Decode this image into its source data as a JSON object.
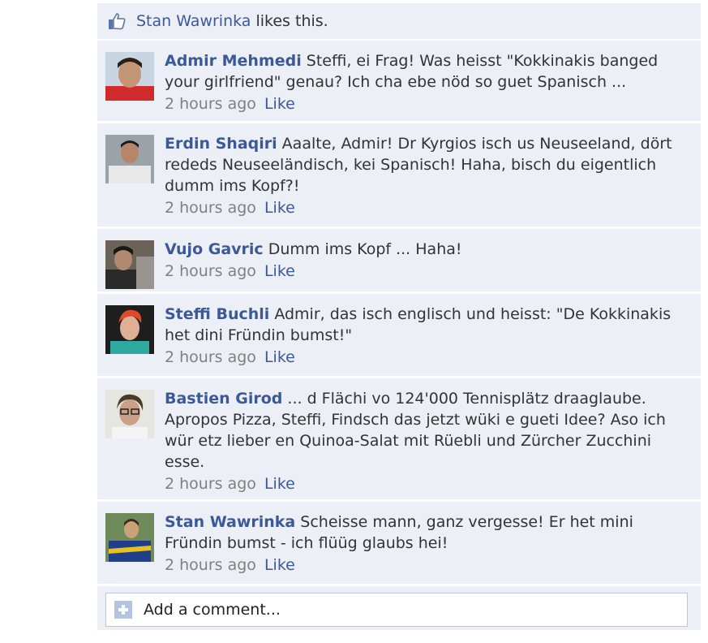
{
  "likes": {
    "name": "Stan Wawrinka",
    "suffix": " likes this."
  },
  "comments": [
    {
      "author": "Admir Mehmedi",
      "text": " Steffi, ei Frag! Was heisst \"Kokkinakis banged your girlfriend\" genau? Ich cha ebe nöd so guet Spanisch ...",
      "time": "2 hours ago",
      "like": "Like",
      "avatar_colors": [
        "#c8d6e4",
        "#d22b2b",
        "#8a5a3c"
      ]
    },
    {
      "author": "Erdin Shaqiri",
      "text": " Aaalte, Admir! Dr Kyrgios isch us Neuseeland, dört rededs Neuseeländisch, kei Spanisch! Haha, bisch du eigentlich dumm ims Kopf?!",
      "time": "2 hours ago",
      "like": "Like",
      "avatar_colors": [
        "#9aa3a8",
        "#e8e8e8",
        "#7a5a48"
      ]
    },
    {
      "author": "Vujo Gavric",
      "text": " Dumm ims Kopf ... Haha!",
      "time": "2 hours ago",
      "like": "Like",
      "avatar_colors": [
        "#6b6258",
        "#2a2a2a",
        "#b08a70"
      ]
    },
    {
      "author": "Steffi Buchli",
      "text": " Admir, das isch englisch und heisst: \"De Kokkinakis het dini Fründin bumst!\"",
      "time": "2 hours ago",
      "like": "Like",
      "avatar_colors": [
        "#1e1e1e",
        "#2fa8a0",
        "#e04a2a"
      ]
    },
    {
      "author": "Bastien Girod",
      "text": " ... d Flächi vo 124'000 Tennisplätz draaglaube. Apropos Pizza, Steffi, Findsch das jetzt wüki e gueti Idee? Aso ich wür etz lieber en Quinoa-Salat mit Rüebli und Zürcher Zucchini esse.",
      "time": "2 hours ago",
      "like": "Like",
      "avatar_colors": [
        "#e6e6e0",
        "#4a3a2a",
        "#caa08a"
      ]
    },
    {
      "author": "Stan Wawrinka",
      "text": " Scheisse mann, ganz vergesse! Er het mini Fründin bumst - ich flüüg glaubs hei!",
      "time": "2 hours ago",
      "like": "Like",
      "avatar_colors": [
        "#6f8a5a",
        "#1f3f8a",
        "#c9a27a"
      ]
    }
  ],
  "add_comment": {
    "placeholder": "Add a comment..."
  },
  "colors": {
    "link": "#3b5998",
    "panel": "#eceff5",
    "muted": "#808080"
  }
}
